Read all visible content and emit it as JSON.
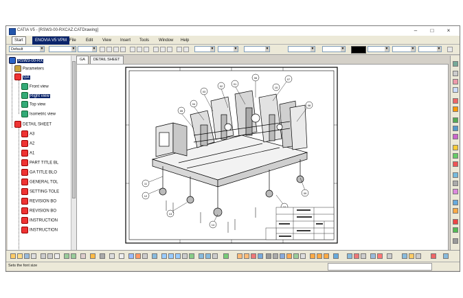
{
  "window": {
    "title": "CATIA V5 - [RSW3-00-RXCAZ.CATDrawing]"
  },
  "menu": {
    "items": [
      "Start",
      "ENOVIA V5 VPM",
      "File",
      "Edit",
      "View",
      "Insert",
      "Tools",
      "Window",
      "Help"
    ]
  },
  "toolbar": {
    "style_combo": "Default"
  },
  "tree": {
    "root": "RSW3-00-RX",
    "parameters": "Parameters",
    "sheet_ga": "GA",
    "front_view": "Front view",
    "right_view": "Right view",
    "top_view": "Top view",
    "isometric_view": "Isometric view",
    "detail_sheet": "DETAIL SHEET",
    "details": [
      "A3",
      "A2",
      "A1",
      "PART TITLE BL",
      "GA TITLE BLO",
      "GENERAL TOL",
      "SETTING TOLE",
      "REVISION BO",
      "REVISION BO",
      "INSTRUCTION",
      "INSTRUCTION"
    ]
  },
  "tabs": [
    "GA",
    "DETAIL SHEET"
  ],
  "drawing": {
    "balloons": [
      "01",
      "02",
      "03",
      "04",
      "05",
      "06",
      "07",
      "08",
      "09",
      "10",
      "11",
      "12",
      "13",
      "14",
      "15"
    ]
  },
  "status": {
    "text": "Sets the font size"
  },
  "colors": {
    "selection": "#0a246a",
    "sheet_icon": "#e33333",
    "view_icon": "#33aa77"
  }
}
